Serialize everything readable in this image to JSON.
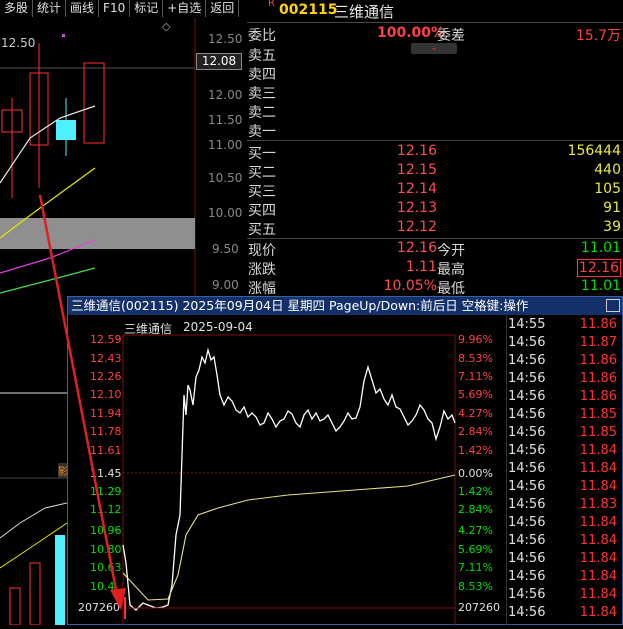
{
  "toolbar": {
    "items": [
      "多股",
      "统计",
      "画线",
      "F10",
      "标记",
      "+自选",
      "返回"
    ]
  },
  "kchart": {
    "price_labels": [
      "12.50",
      "12.00",
      "11.50",
      "11.00",
      "10.50",
      "10.00",
      "9.50",
      "9.00"
    ],
    "current_price_tag": "12.08",
    "top_left_label": "12.50",
    "mini_labels": [
      "影"
    ]
  },
  "quote": {
    "code": "002115",
    "name": "三维通信",
    "r_badge": "R",
    "weibi_label": "委比",
    "weibi_value": "100.00%",
    "weicha_label": "委差",
    "weicha_value": "15.7万",
    "sell": [
      {
        "label": "卖五"
      },
      {
        "label": "卖四"
      },
      {
        "label": "卖三"
      },
      {
        "label": "卖二"
      },
      {
        "label": "卖一"
      }
    ],
    "buy": [
      {
        "label": "买一",
        "price": "12.16",
        "vol": "156444"
      },
      {
        "label": "买二",
        "price": "12.15",
        "vol": "440"
      },
      {
        "label": "买三",
        "price": "12.14",
        "vol": "105"
      },
      {
        "label": "买四",
        "price": "12.13",
        "vol": "91"
      },
      {
        "label": "买五",
        "price": "12.12",
        "vol": "39"
      }
    ],
    "stats": [
      {
        "l1": "现价",
        "v1": "12.16",
        "l2": "今开",
        "v2": "11.01"
      },
      {
        "l1": "涨跌",
        "v1": "1.11",
        "l2": "最高",
        "v2": "12.16"
      },
      {
        "l1": "涨幅",
        "v1": "10.05%",
        "l2": "最低",
        "v2": "11.01"
      }
    ]
  },
  "popup": {
    "title": "三维通信(002115) 2025年09月04日 星期四 PageUp/Down:前后日 空格键:操作",
    "subtitle_name": "三维通信",
    "subtitle_date": "2025-09-04",
    "left_axis": [
      "12.59",
      "12.43",
      "12.26",
      "12.10",
      "11.94",
      "11.78",
      "11.61",
      "11.45",
      "11.29",
      "11.12",
      "10.96",
      "10.80",
      "10.63",
      "10.4"
    ],
    "right_axis": [
      "9.96%",
      "8.53%",
      "7.11%",
      "5.69%",
      "4.27%",
      "2.84%",
      "1.42%",
      "0.00%",
      "1.42%",
      "2.84%",
      "4.27%",
      "5.69%",
      "7.11%",
      "8.53%"
    ],
    "vol_left": "207260",
    "vol_right": "207260",
    "ticks": [
      {
        "t": "14:55",
        "p": "11.86"
      },
      {
        "t": "14:56",
        "p": "11.87"
      },
      {
        "t": "14:56",
        "p": "11.86"
      },
      {
        "t": "14:56",
        "p": "11.86"
      },
      {
        "t": "14:56",
        "p": "11.86"
      },
      {
        "t": "14:56",
        "p": "11.85"
      },
      {
        "t": "14:56",
        "p": "11.85"
      },
      {
        "t": "14:56",
        "p": "11.84"
      },
      {
        "t": "14:56",
        "p": "11.84"
      },
      {
        "t": "14:56",
        "p": "11.84"
      },
      {
        "t": "14:56",
        "p": "11.83"
      },
      {
        "t": "14:56",
        "p": "11.84"
      },
      {
        "t": "14:56",
        "p": "11.84"
      },
      {
        "t": "14:56",
        "p": "11.84"
      },
      {
        "t": "14:56",
        "p": "11.84"
      },
      {
        "t": "14:56",
        "p": "11.84"
      },
      {
        "t": "14:56",
        "p": "11.84"
      }
    ]
  }
}
